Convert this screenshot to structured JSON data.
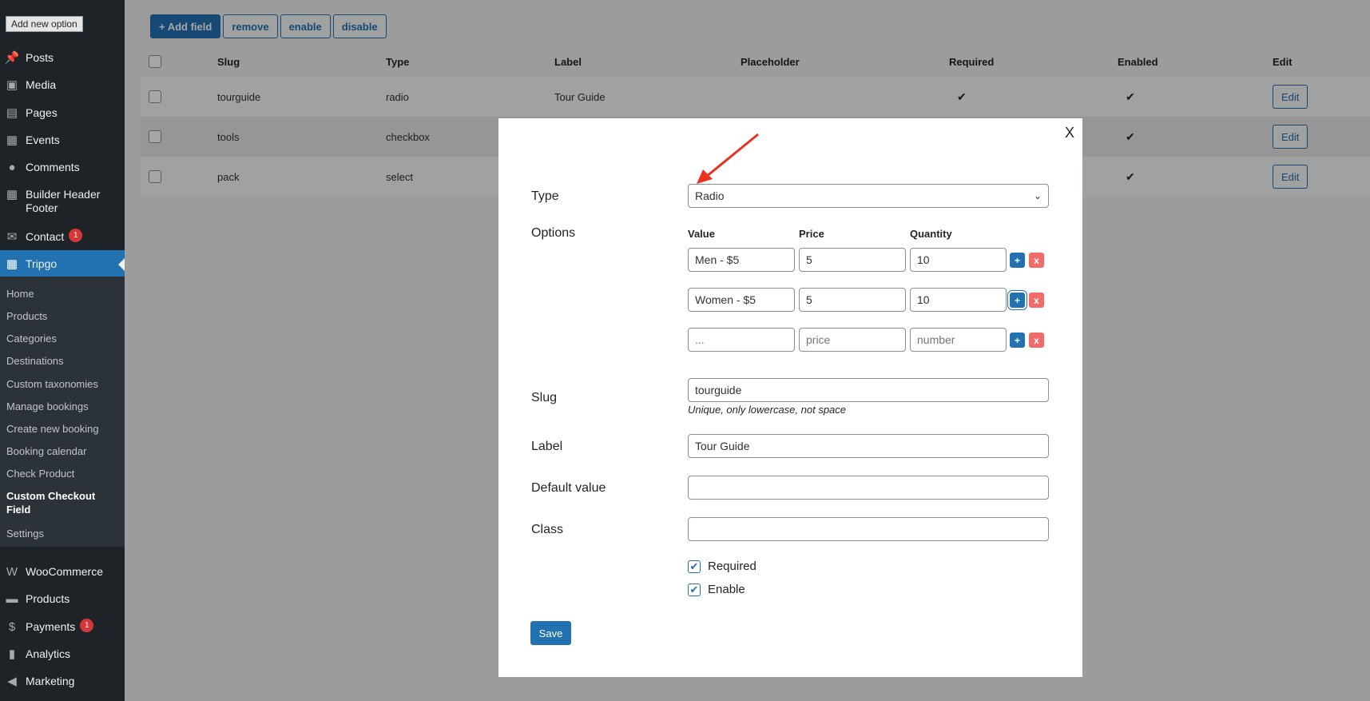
{
  "tooltip": "Add new option",
  "sidebar": {
    "items": [
      {
        "label": "Posts",
        "icon": "pushpin-icon"
      },
      {
        "label": "Media",
        "icon": "media-icon"
      },
      {
        "label": "Pages",
        "icon": "pages-icon"
      },
      {
        "label": "Events",
        "icon": "calendar-icon"
      },
      {
        "label": "Comments",
        "icon": "comment-icon"
      },
      {
        "label": "Builder Header Footer",
        "icon": "grid-icon"
      },
      {
        "label": "Contact",
        "icon": "envelope-icon",
        "badge": "1"
      },
      {
        "label": "Tripgo",
        "icon": "calendar-icon"
      },
      {
        "label": "WooCommerce",
        "icon": "woo-icon"
      },
      {
        "label": "Products",
        "icon": "archive-icon"
      },
      {
        "label": "Payments",
        "icon": "payments-icon",
        "badge": "1"
      },
      {
        "label": "Analytics",
        "icon": "bar-chart-icon"
      },
      {
        "label": "Marketing",
        "icon": "megaphone-icon"
      }
    ],
    "submenu": [
      "Home",
      "Products",
      "Categories",
      "Destinations",
      "Custom taxonomies",
      "Manage bookings",
      "Create new booking",
      "Booking calendar",
      "Check Product",
      "Custom Checkout Field",
      "Settings"
    ]
  },
  "toolbar": {
    "add_field": "+ Add field",
    "remove": "remove",
    "enable": "enable",
    "disable": "disable"
  },
  "table": {
    "headers": [
      "Slug",
      "Type",
      "Label",
      "Placeholder",
      "Required",
      "Enabled",
      "Edit"
    ],
    "rows": [
      {
        "slug": "tourguide",
        "type": "radio",
        "label": "Tour Guide",
        "placeholder": "",
        "required": "✔",
        "enabled": "✔",
        "edit": "Edit"
      },
      {
        "slug": "tools",
        "type": "checkbox",
        "label": "",
        "placeholder": "",
        "required": "",
        "enabled": "✔",
        "edit": "Edit"
      },
      {
        "slug": "pack",
        "type": "select",
        "label": "",
        "placeholder": "",
        "required": "",
        "enabled": "✔",
        "edit": "Edit"
      }
    ]
  },
  "modal": {
    "close": "X",
    "type_label": "Type",
    "type_value": "Radio",
    "options_label": "Options",
    "options_headers": {
      "value": "Value",
      "price": "Price",
      "quantity": "Quantity"
    },
    "options": [
      {
        "value": "Men - $5",
        "price": "5",
        "quantity": "10"
      },
      {
        "value": "Women - $5",
        "price": "5",
        "quantity": "10"
      }
    ],
    "new_option_placeholders": {
      "value": "...",
      "price": "price",
      "quantity": "number"
    },
    "add_symbol": "+",
    "del_symbol": "x",
    "slug_label": "Slug",
    "slug_value": "tourguide",
    "slug_hint": "Unique, only lowercase, not space",
    "label_label": "Label",
    "label_value": "Tour Guide",
    "default_label": "Default value",
    "default_value": "",
    "class_label": "Class",
    "class_value": "",
    "required_label": "Required",
    "enable_label": "Enable",
    "save": "Save"
  },
  "colors": {
    "accent": "#2271b1",
    "sidebar_bg": "#1d2327",
    "delete": "#f26b6b",
    "arrow": "#e8321e"
  }
}
